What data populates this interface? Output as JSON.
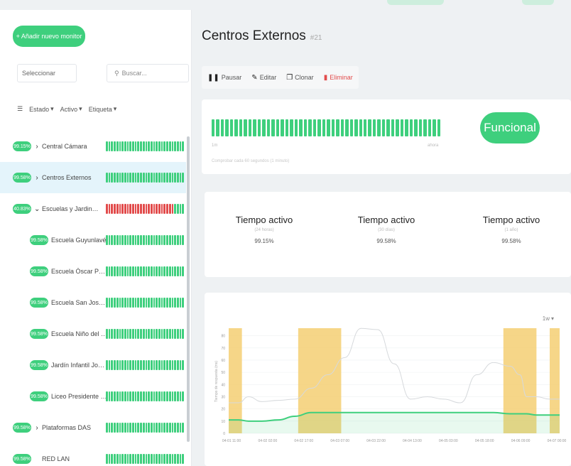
{
  "sidebar": {
    "add_button": "+ Añadir nuevo monitor",
    "select_placeholder": "Seleccionar",
    "search_placeholder": "Buscar...",
    "filters": [
      {
        "label": "Estado"
      },
      {
        "label": "Activo"
      },
      {
        "label": "Etiqueta"
      }
    ],
    "items": [
      {
        "badge": "99.15%",
        "caret": "›",
        "label": "Central Cámara",
        "indent": false,
        "active": false,
        "bars": "green"
      },
      {
        "badge": "99.58%",
        "caret": "›",
        "label": "Centros Externos",
        "indent": false,
        "active": true,
        "bars": "green"
      },
      {
        "badge": "40.83%",
        "caret": "⌄",
        "label": "Escuelas y Jardines",
        "indent": false,
        "active": false,
        "bars": "red"
      },
      {
        "badge": "99.58%",
        "caret": "",
        "label": "Escuela Guyunlavé",
        "indent": true,
        "active": false,
        "bars": "green"
      },
      {
        "badge": "99.58%",
        "caret": "",
        "label": "Escuela Óscar Pérez...",
        "indent": true,
        "active": false,
        "bars": "green"
      },
      {
        "badge": "99.58%",
        "caret": "",
        "label": "Escuela San José Ob...",
        "indent": true,
        "active": false,
        "bars": "green"
      },
      {
        "badge": "99.58%",
        "caret": "",
        "label": "Escuela Niño del Pue...",
        "indent": true,
        "active": false,
        "bars": "green"
      },
      {
        "badge": "99.58%",
        "caret": "",
        "label": "Jardín Infantil Joaquí...",
        "indent": true,
        "active": false,
        "bars": "green"
      },
      {
        "badge": "99.58%",
        "caret": "",
        "label": "Liceo Presidente Bal...",
        "indent": true,
        "active": false,
        "bars": "green"
      },
      {
        "badge": "99.58%",
        "caret": "›",
        "label": "Plataformas DAS",
        "indent": false,
        "active": false,
        "bars": "green"
      },
      {
        "badge": "99.58%",
        "caret": "",
        "label": "RED LAN",
        "indent": false,
        "active": false,
        "bars": "green"
      }
    ]
  },
  "main": {
    "title": "Centros Externos",
    "title_id": "#21",
    "toolbar": [
      {
        "icon": "pause-icon",
        "glyph": "❚❚",
        "label": "Pausar"
      },
      {
        "icon": "edit-icon",
        "glyph": "✎",
        "label": "Editar"
      },
      {
        "icon": "clone-icon",
        "glyph": "❐",
        "label": "Clonar"
      },
      {
        "icon": "delete-icon",
        "glyph": "▮",
        "label": "Eliminar"
      }
    ],
    "status": {
      "label": "Funcional",
      "bar_start": "1m",
      "bar_end": "ahora",
      "note": "Comprobar cada 60 segundos (1 minuto)",
      "colors": {
        "up": "#3ecf7d",
        "down": "#e24b4b"
      }
    },
    "uptime": [
      {
        "title": "Tiempo activo",
        "sub": "(24 horas)",
        "value": "99.15%"
      },
      {
        "title": "Tiempo activo",
        "sub": "(30 días)",
        "value": "99.58%"
      },
      {
        "title": "Tiempo activo",
        "sub": "(1 año)",
        "value": "99.58%"
      }
    ],
    "chart_range": "1w"
  },
  "chart_data": {
    "type": "line",
    "y_ticks": [
      "80",
      "70",
      "60",
      "50",
      "40",
      "30",
      "20",
      "10",
      "0"
    ],
    "x_ticks": [
      "04-01 11:00",
      "04-02 02:00",
      "04-02 17:00",
      "04-03 07:00",
      "04-03 22:00",
      "04-04 13:00",
      "04-05 03:00",
      "04-05 18:00",
      "04-06 09:00",
      "04-07 00:00"
    ],
    "ylabel": "Tiempo de respuesta (ms)",
    "ylim": [
      0,
      85
    ],
    "x": [
      0,
      0.03,
      0.06,
      0.1,
      0.15,
      0.2,
      0.25,
      0.3,
      0.35,
      0.4,
      0.45,
      0.5,
      0.55,
      0.6,
      0.65,
      0.7,
      0.75,
      0.8,
      0.85,
      0.88,
      0.9,
      0.93,
      0.97,
      1.0
    ],
    "series": [
      {
        "name": "",
        "color": "#3ecf7d",
        "values": [
          11,
          11,
          10,
          10,
          11,
          14,
          17,
          17,
          17,
          17,
          17,
          17,
          17,
          17,
          17,
          17,
          17,
          17,
          16,
          16,
          16,
          15,
          15,
          15
        ]
      },
      {
        "name": "",
        "color": "#d6d9dc",
        "values": [
          25,
          25,
          30,
          26,
          27,
          28,
          37,
          48,
          62,
          86,
          85,
          57,
          28,
          30,
          28,
          25,
          48,
          58,
          55,
          48,
          30,
          30,
          28,
          28
        ]
      }
    ],
    "down_bands": [
      [
        0,
        0.04
      ],
      [
        0.21,
        0.34
      ],
      [
        0.83,
        0.93
      ],
      [
        0.97,
        1.0
      ]
    ],
    "band_color": "#f4cf73"
  }
}
